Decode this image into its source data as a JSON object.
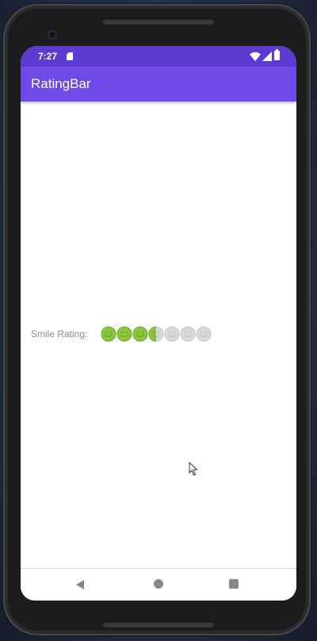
{
  "status_bar": {
    "time": "7:27",
    "icons": [
      "sd-card-icon",
      "wifi-icon",
      "signal-icon",
      "battery-icon"
    ]
  },
  "app_bar": {
    "title": "RatingBar"
  },
  "rating": {
    "label": "Smile Rating:",
    "num_stars": 7,
    "value": 3.5,
    "active_color": "#8cc63f",
    "inactive_color": "#d9d9d9"
  },
  "nav_bar": {
    "icons": [
      "back-icon",
      "home-icon",
      "recents-icon"
    ]
  },
  "colors": {
    "status_bar": "#5b3bd1",
    "app_bar": "#6d4be8"
  }
}
